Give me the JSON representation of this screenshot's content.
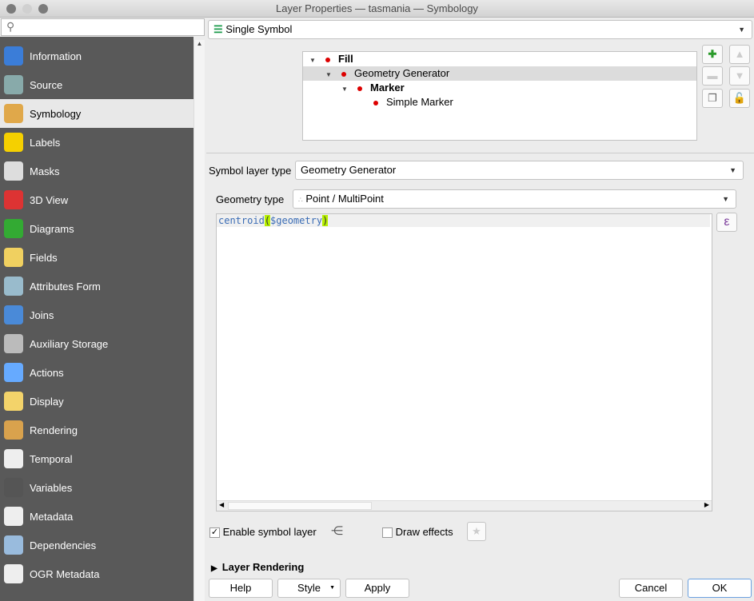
{
  "window": {
    "title": "Layer Properties — tasmania — Symbology"
  },
  "search": {
    "placeholder": ""
  },
  "sidebar": {
    "items": [
      {
        "label": "Information",
        "icon": "info-icon",
        "color": "#3b7dd8"
      },
      {
        "label": "Source",
        "icon": "source-icon",
        "color": "#8aa"
      },
      {
        "label": "Symbology",
        "icon": "paintbrush-icon",
        "color": "#e0a84a"
      },
      {
        "label": "Labels",
        "icon": "labels-abc-icon",
        "color": "#f5d000"
      },
      {
        "label": "Masks",
        "icon": "masks-abc-icon",
        "color": "#ddd"
      },
      {
        "label": "3D View",
        "icon": "3d-cube-icon",
        "color": "#d33"
      },
      {
        "label": "Diagrams",
        "icon": "diagrams-icon",
        "color": "#3a3"
      },
      {
        "label": "Fields",
        "icon": "fields-icon",
        "color": "#f0d060"
      },
      {
        "label": "Attributes Form",
        "icon": "form-icon",
        "color": "#9bc"
      },
      {
        "label": "Joins",
        "icon": "joins-icon",
        "color": "#4a8ad8"
      },
      {
        "label": "Auxiliary Storage",
        "icon": "database-icon",
        "color": "#bbb"
      },
      {
        "label": "Actions",
        "icon": "actions-gear-icon",
        "color": "#6af"
      },
      {
        "label": "Display",
        "icon": "speech-bubble-icon",
        "color": "#f3d36a"
      },
      {
        "label": "Rendering",
        "icon": "brush-icon",
        "color": "#d9a24d"
      },
      {
        "label": "Temporal",
        "icon": "clock-icon",
        "color": "#eee"
      },
      {
        "label": "Variables",
        "icon": "epsilon-icon",
        "color": "#555"
      },
      {
        "label": "Metadata",
        "icon": "metadata-icon",
        "color": "#eee"
      },
      {
        "label": "Dependencies",
        "icon": "dependencies-icon",
        "color": "#9bd"
      },
      {
        "label": "OGR Metadata",
        "icon": "ogr-icon",
        "color": "#eee"
      }
    ],
    "selected": "Symbology"
  },
  "renderer": {
    "value": "Single Symbol"
  },
  "tree": [
    {
      "label": "Fill",
      "bold": true,
      "indent": 0,
      "expander": true
    },
    {
      "label": "Geometry Generator",
      "bold": false,
      "indent": 1,
      "expander": true,
      "selected": true
    },
    {
      "label": "Marker",
      "bold": true,
      "indent": 2,
      "expander": true
    },
    {
      "label": "Simple Marker",
      "bold": false,
      "indent": 3,
      "expander": false
    }
  ],
  "symbol_layer_type": {
    "label": "Symbol layer type",
    "value": "Geometry Generator"
  },
  "geometry_type": {
    "label": "Geometry type",
    "value": "Point / MultiPoint"
  },
  "expression": {
    "fn": "centroid",
    "open": "(",
    "arg": "$geometry",
    "close": ")"
  },
  "expression_button": "ε",
  "enable_symbol_layer": {
    "label": "Enable symbol layer",
    "checked": true
  },
  "draw_effects": {
    "label": "Draw effects",
    "checked": false
  },
  "layer_rendering": {
    "label": "Layer Rendering"
  },
  "buttons": {
    "help": "Help",
    "style": "Style",
    "apply": "Apply",
    "cancel": "Cancel",
    "ok": "OK"
  }
}
